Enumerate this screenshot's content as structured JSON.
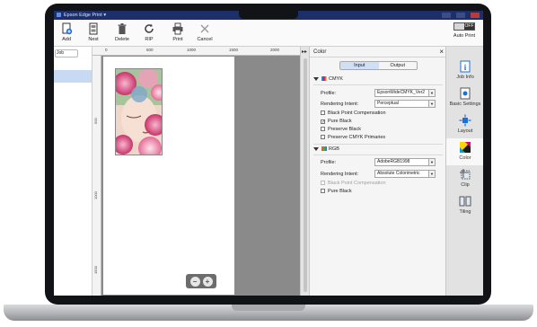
{
  "window": {
    "title": "Epson Edge Print"
  },
  "toolbar": {
    "buttons": [
      {
        "label": "Add",
        "icon": "add-document-icon"
      },
      {
        "label": "Nest",
        "icon": "nest-icon"
      },
      {
        "label": "Delete",
        "icon": "trash-icon"
      },
      {
        "label": "RIP",
        "icon": "rip-refresh-icon"
      },
      {
        "label": "Print",
        "icon": "printer-icon"
      },
      {
        "label": "Cancel",
        "icon": "cancel-x-icon"
      }
    ],
    "auto_print": {
      "label": "Auto Print",
      "state": "OFF"
    }
  },
  "job_list": {
    "search_text": "Job"
  },
  "preview": {
    "ruler_top": [
      "0",
      "500",
      "1000",
      "1500",
      "2000"
    ],
    "ruler_left": [
      "500",
      "1000",
      "1500"
    ]
  },
  "color_panel": {
    "title": "Color",
    "tabs": {
      "input": "Input",
      "output": "Output",
      "selected": "Input"
    },
    "cmyk": {
      "header": "CMYK",
      "profile_label": "Profile:",
      "profile_value": "EpsonWideCMYK_Ver2",
      "intent_label": "Rendering Intent:",
      "intent_value": "Perceptual",
      "checks": [
        {
          "label": "Black Point Compensation",
          "checked": false,
          "enabled": true
        },
        {
          "label": "Pure Black",
          "checked": true,
          "enabled": true
        },
        {
          "label": "Preserve Black",
          "checked": false,
          "enabled": true
        },
        {
          "label": "Preserve CMYK Primaries",
          "checked": false,
          "enabled": true
        }
      ]
    },
    "rgb": {
      "header": "RGB",
      "profile_label": "Profile:",
      "profile_value": "AdobeRGB1998",
      "intent_label": "Rendering Intent:",
      "intent_value": "Absolute Colorimetric",
      "checks": [
        {
          "label": "Black Point Compensation",
          "checked": false,
          "enabled": false
        },
        {
          "label": "Pure Black",
          "checked": false,
          "enabled": true
        }
      ]
    }
  },
  "side_rail": {
    "items": [
      {
        "label": "Job Info",
        "icon": "info-icon"
      },
      {
        "label": "Basic Settings",
        "icon": "settings-icon"
      },
      {
        "label": "Layout",
        "icon": "layout-icon"
      },
      {
        "label": "Color",
        "icon": "color-icon"
      },
      {
        "label": "Clip",
        "icon": "clip-icon"
      },
      {
        "label": "Tiling",
        "icon": "tiling-icon"
      }
    ],
    "active": "Color"
  },
  "colors": {
    "titlebar": "#1c2f6b",
    "accent": "#cfe0f6",
    "preview_bg": "#8a8a8a"
  }
}
